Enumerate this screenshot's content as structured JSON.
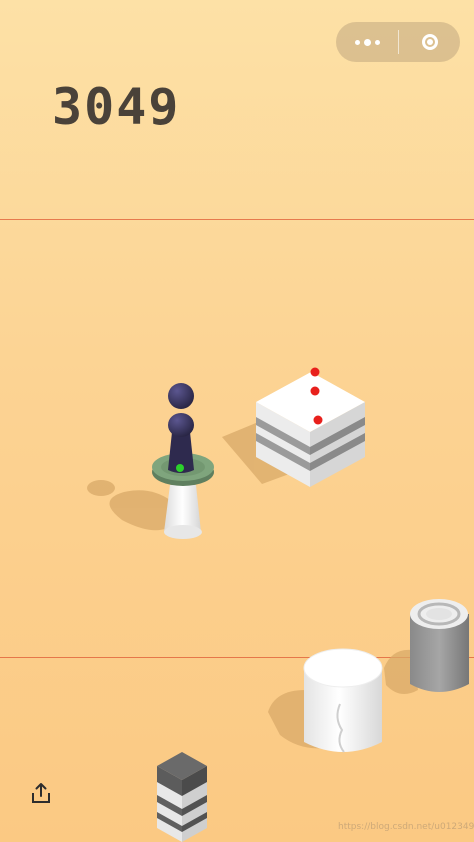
{
  "score": "3049",
  "watermark": "https://blog.csdn.net/u012349",
  "icons": {
    "menu": "more-dots-icon",
    "close": "close-circle-icon",
    "share": "share-icon"
  },
  "colors": {
    "background_top": "#fde1a6",
    "background_bottom": "#fbc983",
    "score_text": "#4a4239",
    "guide_line": "#e0623a",
    "player": "#2e2a4e",
    "dot_red": "#e8201c",
    "dot_green": "#2bd12b"
  }
}
